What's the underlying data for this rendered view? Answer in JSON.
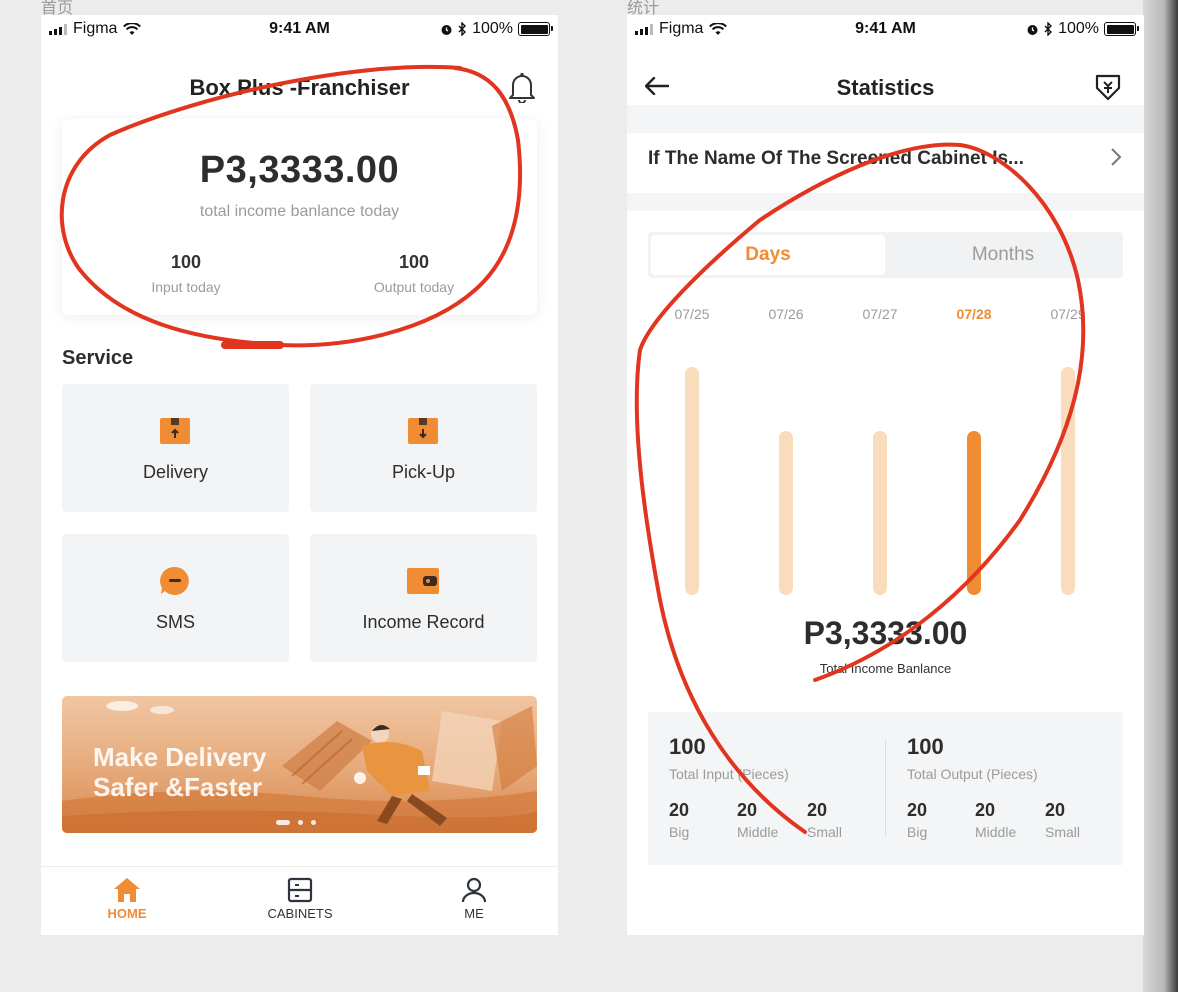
{
  "canvas": {
    "home_label": "首页",
    "stats_label": "统计"
  },
  "status_bar": {
    "carrier": "Figma",
    "time": "9:41 AM",
    "battery": "100%",
    "battery_level": 1.0
  },
  "home": {
    "title": "Box Plus -Franchiser",
    "balance": {
      "amount": "P3,3333.00",
      "caption": "total income banlance today",
      "input_value": "100",
      "input_label": "Input today",
      "output_value": "100",
      "output_label": "Output today"
    },
    "section_title": "Service",
    "services": [
      {
        "label": "Delivery",
        "icon": "delivery-box-icon"
      },
      {
        "label": "Pick-Up",
        "icon": "pickup-box-icon"
      },
      {
        "label": "SMS",
        "icon": "sms-chat-icon"
      },
      {
        "label": "Income Record",
        "icon": "wallet-icon"
      }
    ],
    "banner": {
      "line1": "Make Delivery",
      "line2": "Safer &Faster",
      "slide_count": 3,
      "active_slide": 1
    },
    "tabs": [
      {
        "label": "HOME",
        "icon": "home-icon",
        "active": true
      },
      {
        "label": "CABINETS",
        "icon": "cabinet-icon",
        "active": false
      },
      {
        "label": "ME",
        "icon": "person-icon",
        "active": false
      }
    ]
  },
  "stats": {
    "title": "Statistics",
    "filter_text": "If The Name Of The Screened Cabinet Is...",
    "segments": {
      "days": "Days",
      "months": "Months",
      "active": "Days"
    },
    "total_amount": "P3,3333.00",
    "total_label": "Total Income Banlance",
    "input": {
      "value": "100",
      "label": "Total Input (Pieces)",
      "items": [
        {
          "value": "20",
          "label": "Big"
        },
        {
          "value": "20",
          "label": "Middle"
        },
        {
          "value": "20",
          "label": "Small"
        }
      ]
    },
    "output": {
      "value": "100",
      "label": "Total Output (Pieces)",
      "items": [
        {
          "value": "20",
          "label": "Big"
        },
        {
          "value": "20",
          "label": "Middle"
        },
        {
          "value": "20",
          "label": "Small"
        }
      ]
    }
  },
  "colors": {
    "accent": "#ef8c34",
    "bar_light": "#f9dcbc",
    "annotation_red": "#e2351f"
  },
  "chart_data": {
    "type": "bar",
    "categories": [
      "07/25",
      "07/26",
      "07/27",
      "07/28",
      "07/29"
    ],
    "values": [
      1.0,
      0.72,
      0.72,
      0.72,
      1.0
    ],
    "highlighted": "07/28",
    "title": "",
    "xlabel": "",
    "ylabel": ""
  }
}
